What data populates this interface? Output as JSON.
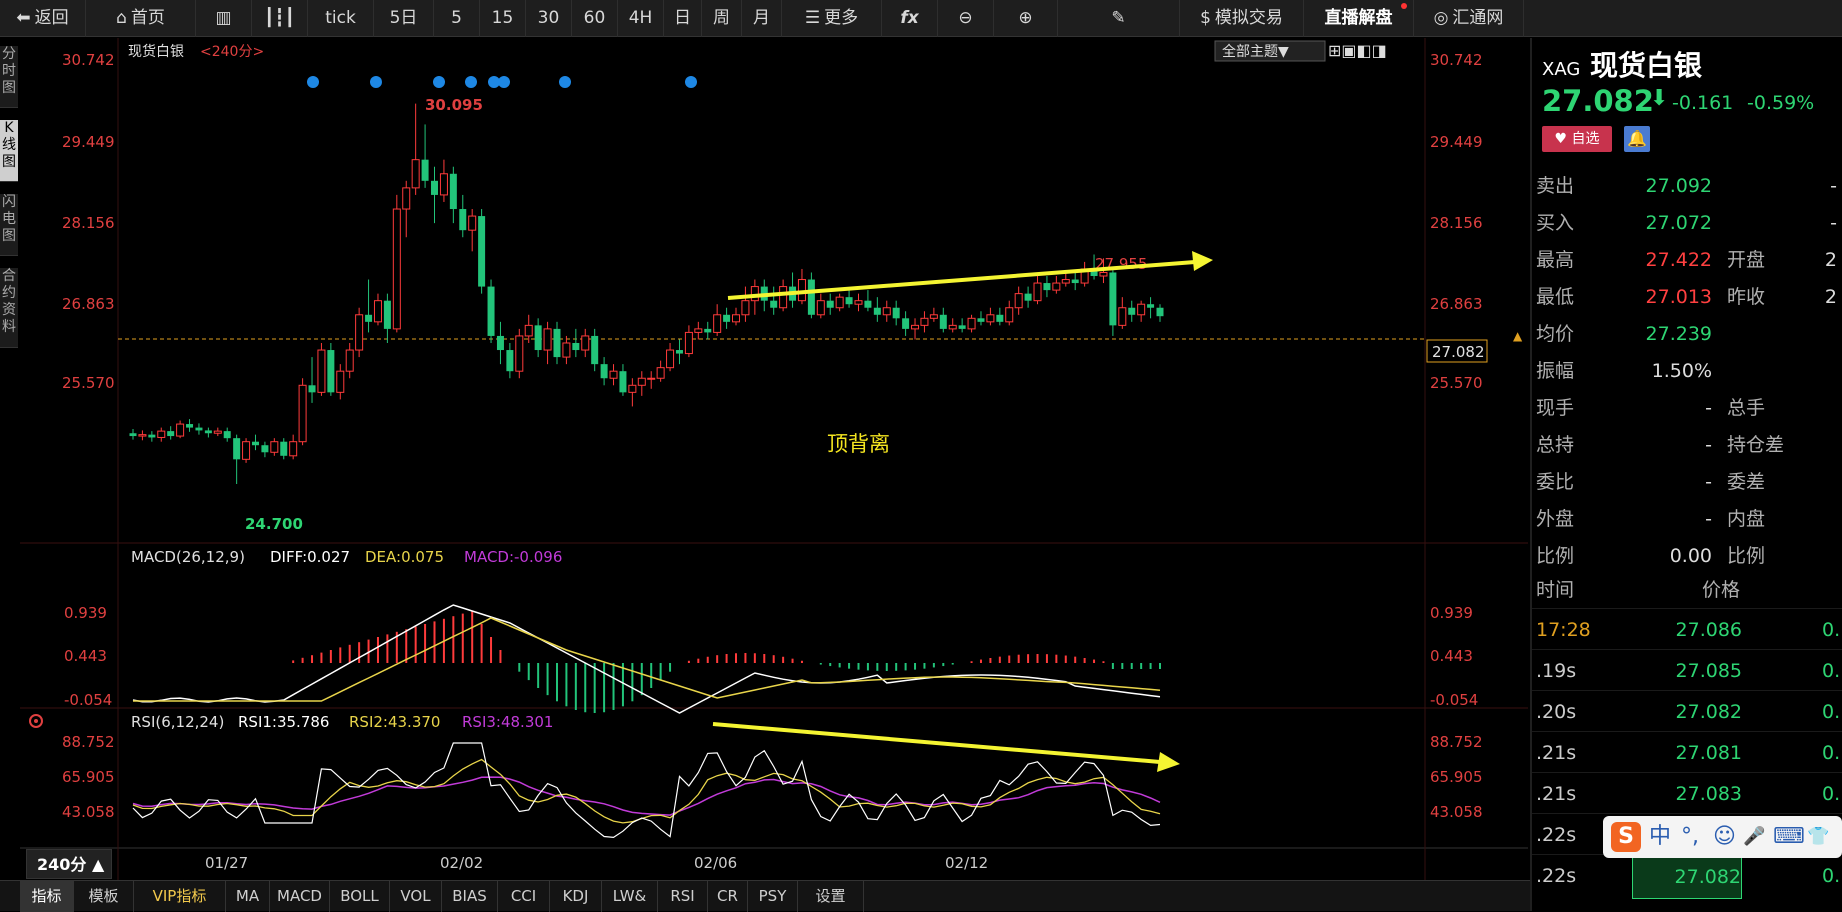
{
  "toolbar": {
    "back": "返回",
    "home": "首页",
    "items": [
      "tick",
      "5日",
      "5",
      "15",
      "30",
      "60",
      "4H",
      "日",
      "周",
      "月"
    ],
    "more": "更多",
    "fx": "fx",
    "sim_trade": "模拟交易",
    "live": "直播解盘",
    "brand": "汇通网"
  },
  "left_tabs": [
    "分时图",
    "K线图",
    "闪电图",
    "合约资料"
  ],
  "chart": {
    "title": "现货白银",
    "period_label": "<240分>",
    "theme_button": "全部主题▼",
    "price_axis": [
      "30.742",
      "29.449",
      "28.156",
      "26.863",
      "25.570"
    ],
    "high_label": "30.095",
    "low_label": "24.700",
    "recent_high_label": "27.955",
    "current_price_tag": "27.082",
    "annotation": "顶背离",
    "dates": [
      "01/27",
      "02/02",
      "02/06",
      "02/12"
    ],
    "macd_header": "MACD(26,12,9)",
    "diff": "DIFF:0.027",
    "dea": "DEA:0.075",
    "macd_val": "MACD:-0.096",
    "macd_axis": [
      "0.939",
      "0.443",
      "-0.054"
    ],
    "rsi_header": "RSI(6,12,24)",
    "rsi1": "RSI1:35.786",
    "rsi2": "RSI2:43.370",
    "rsi3": "RSI3:48.301",
    "rsi_axis": [
      "88.752",
      "65.905",
      "43.058"
    ],
    "colors": {
      "up": "#ff3b3b",
      "down": "#22c47a",
      "price_text": "#e04040",
      "diff": "#ffffff",
      "dea": "#e8d44a",
      "rsi3": "#c13bd8"
    }
  },
  "chart_data": {
    "type": "candlestick",
    "title": "现货白银",
    "period": "240分",
    "ylim": [
      25.0,
      30.742
    ],
    "candles": [
      [
        25.42,
        25.38,
        25.48,
        25.33
      ],
      [
        25.38,
        25.4,
        25.46,
        25.32
      ],
      [
        25.4,
        25.36,
        25.45,
        25.3
      ],
      [
        25.36,
        25.45,
        25.5,
        25.3
      ],
      [
        25.45,
        25.38,
        25.52,
        25.33
      ],
      [
        25.38,
        25.55,
        25.6,
        25.35
      ],
      [
        25.55,
        25.5,
        25.62,
        25.44
      ],
      [
        25.5,
        25.46,
        25.56,
        25.4
      ],
      [
        25.46,
        25.42,
        25.5,
        25.36
      ],
      [
        25.42,
        25.45,
        25.5,
        25.38
      ],
      [
        25.45,
        25.35,
        25.5,
        25.3
      ],
      [
        25.35,
        25.05,
        25.4,
        24.7
      ],
      [
        25.05,
        25.3,
        25.35,
        25.0
      ],
      [
        25.3,
        25.25,
        25.4,
        25.18
      ],
      [
        25.25,
        25.15,
        25.3,
        25.08
      ],
      [
        25.15,
        25.3,
        25.35,
        25.1
      ],
      [
        25.3,
        25.1,
        25.35,
        25.05
      ],
      [
        25.1,
        25.3,
        25.4,
        25.05
      ],
      [
        25.3,
        26.1,
        26.2,
        25.25
      ],
      [
        26.1,
        26.0,
        26.5,
        25.85
      ],
      [
        26.0,
        26.6,
        26.7,
        25.95
      ],
      [
        26.6,
        26.0,
        26.7,
        25.95
      ],
      [
        26.0,
        26.3,
        26.4,
        25.9
      ],
      [
        26.3,
        26.6,
        26.7,
        26.2
      ],
      [
        26.6,
        27.1,
        27.2,
        26.5
      ],
      [
        27.1,
        27.0,
        27.6,
        26.85
      ],
      [
        27.0,
        27.3,
        27.4,
        26.95
      ],
      [
        27.3,
        26.9,
        27.4,
        26.7
      ],
      [
        26.9,
        28.6,
        28.8,
        26.85
      ],
      [
        28.6,
        28.9,
        29.0,
        28.2
      ],
      [
        28.9,
        29.3,
        30.095,
        28.8
      ],
      [
        29.3,
        29.0,
        29.8,
        28.9
      ],
      [
        29.0,
        28.8,
        29.2,
        28.4
      ],
      [
        28.8,
        29.1,
        29.3,
        28.7
      ],
      [
        29.1,
        28.6,
        29.2,
        28.4
      ],
      [
        28.6,
        28.3,
        28.8,
        28.2
      ],
      [
        28.3,
        28.5,
        28.6,
        28.0
      ],
      [
        28.5,
        27.5,
        28.6,
        27.4
      ],
      [
        27.5,
        26.8,
        27.6,
        26.7
      ],
      [
        26.8,
        26.6,
        27.0,
        26.4
      ],
      [
        26.6,
        26.3,
        26.7,
        26.2
      ],
      [
        26.3,
        26.8,
        26.9,
        26.2
      ],
      [
        26.8,
        26.95,
        27.1,
        26.7
      ],
      [
        26.95,
        26.6,
        27.05,
        26.5
      ],
      [
        26.6,
        26.9,
        27.0,
        26.4
      ],
      [
        26.9,
        26.5,
        27.0,
        26.4
      ],
      [
        26.5,
        26.7,
        26.8,
        26.4
      ],
      [
        26.7,
        26.6,
        26.9,
        26.5
      ],
      [
        26.6,
        26.8,
        26.9,
        26.5
      ],
      [
        26.8,
        26.4,
        26.9,
        26.3
      ],
      [
        26.4,
        26.2,
        26.5,
        26.1
      ],
      [
        26.2,
        26.3,
        26.4,
        26.1
      ],
      [
        26.3,
        26.0,
        26.4,
        25.95
      ],
      [
        26.0,
        26.1,
        26.2,
        25.8
      ],
      [
        26.1,
        26.2,
        26.3,
        25.95
      ],
      [
        26.2,
        26.2,
        26.3,
        26.05
      ],
      [
        26.2,
        26.35,
        26.45,
        26.15
      ],
      [
        26.35,
        26.6,
        26.7,
        26.3
      ],
      [
        26.6,
        26.55,
        26.75,
        26.4
      ],
      [
        26.55,
        26.85,
        26.95,
        26.5
      ],
      [
        26.85,
        26.9,
        27.0,
        26.75
      ],
      [
        26.9,
        26.85,
        27.0,
        26.75
      ],
      [
        26.85,
        27.1,
        27.25,
        26.8
      ],
      [
        27.1,
        27.0,
        27.2,
        26.9
      ],
      [
        27.0,
        27.1,
        27.2,
        26.95
      ],
      [
        27.1,
        27.3,
        27.5,
        27.0
      ],
      [
        27.3,
        27.5,
        27.6,
        27.1
      ],
      [
        27.5,
        27.3,
        27.6,
        27.15
      ],
      [
        27.3,
        27.2,
        27.5,
        27.1
      ],
      [
        27.2,
        27.5,
        27.6,
        27.15
      ],
      [
        27.5,
        27.3,
        27.7,
        27.2
      ],
      [
        27.3,
        27.6,
        27.75,
        27.25
      ],
      [
        27.6,
        27.1,
        27.7,
        27.05
      ],
      [
        27.1,
        27.3,
        27.4,
        27.05
      ],
      [
        27.3,
        27.2,
        27.4,
        27.1
      ],
      [
        27.2,
        27.35,
        27.4,
        27.15
      ],
      [
        27.35,
        27.25,
        27.45,
        27.2
      ],
      [
        27.25,
        27.3,
        27.4,
        27.15
      ],
      [
        27.3,
        27.2,
        27.45,
        27.15
      ],
      [
        27.2,
        27.1,
        27.35,
        27.0
      ],
      [
        27.1,
        27.2,
        27.3,
        27.0
      ],
      [
        27.2,
        27.05,
        27.3,
        26.95
      ],
      [
        27.05,
        26.9,
        27.15,
        26.8
      ],
      [
        26.9,
        26.95,
        27.05,
        26.75
      ],
      [
        26.95,
        27.05,
        27.15,
        26.85
      ],
      [
        27.05,
        27.1,
        27.2,
        27.0
      ],
      [
        27.1,
        26.9,
        27.2,
        26.85
      ],
      [
        26.9,
        26.95,
        27.05,
        26.85
      ],
      [
        26.95,
        26.9,
        27.05,
        26.85
      ],
      [
        26.9,
        27.05,
        27.1,
        26.85
      ],
      [
        27.05,
        27.0,
        27.15,
        26.95
      ],
      [
        27.0,
        27.1,
        27.2,
        26.95
      ],
      [
        27.1,
        27.0,
        27.2,
        26.95
      ],
      [
        27.0,
        27.2,
        27.3,
        26.95
      ],
      [
        27.2,
        27.4,
        27.5,
        27.1
      ],
      [
        27.4,
        27.3,
        27.5,
        27.2
      ],
      [
        27.3,
        27.55,
        27.65,
        27.25
      ],
      [
        27.55,
        27.45,
        27.65,
        27.35
      ],
      [
        27.45,
        27.55,
        27.65,
        27.4
      ],
      [
        27.55,
        27.6,
        27.7,
        27.5
      ],
      [
        27.6,
        27.55,
        27.7,
        27.45
      ],
      [
        27.55,
        27.75,
        27.85,
        27.5
      ],
      [
        27.75,
        27.65,
        27.955,
        27.6
      ],
      [
        27.65,
        27.7,
        27.9,
        27.55
      ],
      [
        27.7,
        26.95,
        27.75,
        26.8
      ],
      [
        26.95,
        27.2,
        27.35,
        26.9
      ],
      [
        27.2,
        27.1,
        27.3,
        27.0
      ],
      [
        27.1,
        27.25,
        27.3,
        27.0
      ],
      [
        27.25,
        27.2,
        27.35,
        27.05
      ],
      [
        27.2,
        27.08,
        27.25,
        27.0
      ]
    ],
    "macd_axis": [
      0.939,
      0.443,
      -0.054
    ],
    "rsi_axis": [
      88.752,
      65.905,
      43.058
    ]
  },
  "right_panel": {
    "symbol_code": "XAG",
    "symbol_name": "现货白银",
    "price": "27.082",
    "arrow": "⬇",
    "change": "-0.161",
    "change_pct": "-0.59%",
    "watch_btn": "自选",
    "quote_rows": [
      {
        "l1": "卖出",
        "v1": "27.092",
        "l2": "",
        "v2": "-"
      },
      {
        "l1": "买入",
        "v1": "27.072",
        "l2": "",
        "v2": "-"
      },
      {
        "l1": "最高",
        "v1": "27.422",
        "l2": "开盘",
        "v2": "2"
      },
      {
        "l1": "最低",
        "v1": "27.013",
        "l2": "昨收",
        "v2": "2"
      },
      {
        "l1": "均价",
        "v1": "27.239",
        "l2": "",
        "v2": ""
      },
      {
        "l1": "振幅",
        "v1": "1.50%",
        "l2": "",
        "v2": ""
      },
      {
        "l1": "现手",
        "v1": "-",
        "l2": "总手",
        "v2": ""
      },
      {
        "l1": "总持",
        "v1": "-",
        "l2": "持仓差",
        "v2": ""
      },
      {
        "l1": "委比",
        "v1": "-",
        "l2": "委差",
        "v2": ""
      },
      {
        "l1": "外盘",
        "v1": "-",
        "l2": "内盘",
        "v2": ""
      },
      {
        "l1": "比例",
        "v1": "0.00",
        "l2": "比例",
        "v2": ""
      }
    ],
    "tick_header_time": "时间",
    "tick_header_price": "价格",
    "ticks": [
      {
        "t": "17:28",
        "p": "27.086",
        "v": "0."
      },
      {
        "t": ".19s",
        "p": "27.085",
        "v": "0."
      },
      {
        "t": ".20s",
        "p": "27.082",
        "v": "0."
      },
      {
        "t": ".21s",
        "p": "27.081",
        "v": "0."
      },
      {
        "t": ".21s",
        "p": "27.083",
        "v": "0."
      },
      {
        "t": ".22s",
        "p": "",
        "v": "0."
      },
      {
        "t": ".22s",
        "p": "27.082",
        "v": "0."
      }
    ]
  },
  "bottom_tabs": [
    "指标",
    "模板",
    "VIP指标",
    "MA",
    "MACD",
    "BOLL",
    "VOL",
    "BIAS",
    "CCI",
    "KDJ",
    "LW&",
    "RSI",
    "CR",
    "PSY",
    "设置"
  ],
  "period_selector": "240分 ▲",
  "ime": {
    "logo": "S",
    "items": [
      "中",
      "°,",
      "☺",
      "🎤",
      "⌨",
      "👕"
    ]
  }
}
